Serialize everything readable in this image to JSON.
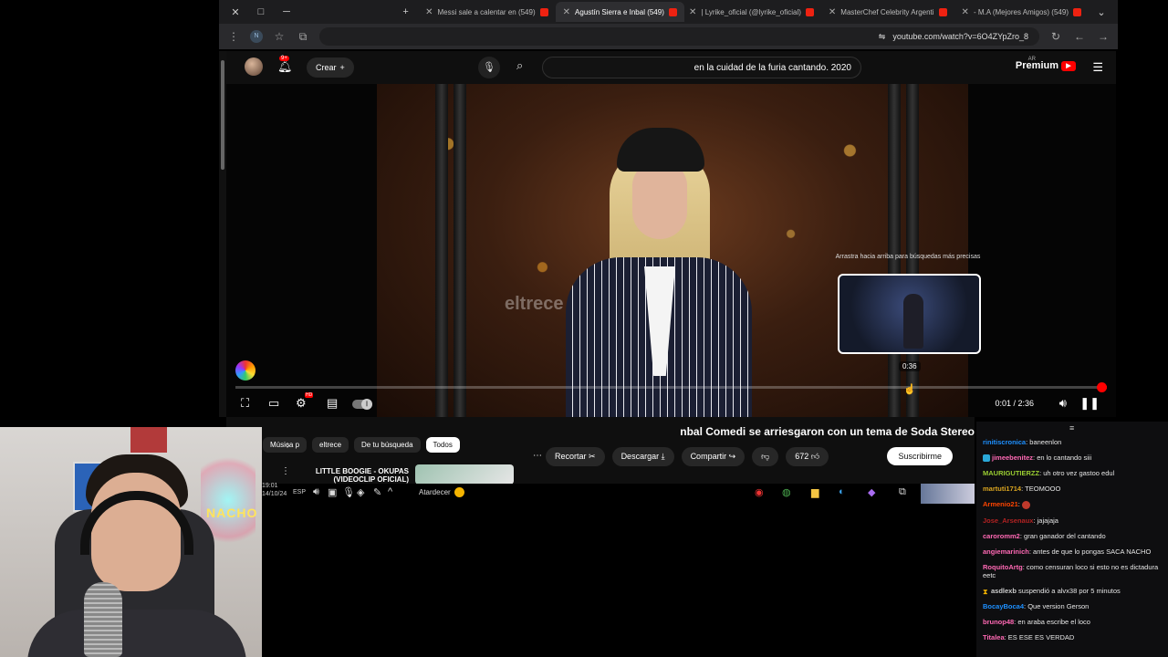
{
  "browser": {
    "tabs": [
      {
        "label": "(549) M.A (Mejores Amigos) -",
        "active": false
      },
      {
        "label": "MasterChef Celebrity Argenti",
        "active": false
      },
      {
        "label": "Lyrike_oficial (@lyrike_oficial) |",
        "active": false
      },
      {
        "label": "(549) Agustín Sierra e Inbal",
        "active": true
      },
      {
        "label": "(549) Messi sale a calentar en",
        "active": false
      }
    ],
    "url": "youtube.com/watch?v=6O4ZYpZro_8",
    "profile_letter": "N"
  },
  "masthead": {
    "logo_text": "Premium",
    "region": "AR",
    "search_query": "en la cuidad de la furia cantando. 2020",
    "create_label": "Crear",
    "notifications_badge": "9+"
  },
  "player": {
    "tooltip": "Arrastra hacia arriba para búsquedas más precisas",
    "preview_time": "0:36",
    "time_display": "0:01 / 2:36",
    "progress": 0.006,
    "watermark": "eltrece"
  },
  "video": {
    "title": "nbal Comedi se arriesgaron con un tema de Soda Stereo",
    "subscribe_label": "Suscribirme",
    "like_count": "672",
    "actions": {
      "share": "Compartir",
      "download": "Descargar",
      "clip": "Recortar"
    }
  },
  "chips": [
    {
      "label": "Todos",
      "active": true
    },
    {
      "label": "De tu búsqueda",
      "active": false
    },
    {
      "label": "eltrece",
      "active": false
    },
    {
      "label": "Música p",
      "active": false
    }
  ],
  "recommended": {
    "title": "LITTLE BOOGIE - OKUPAS (VIDEOCLIP OFICIAL)"
  },
  "taskbar": {
    "weather": "Atardecer",
    "lang": "ESP",
    "time": "19:01",
    "date": "14/10/24"
  },
  "webcam": {
    "neon_text": "NACHO"
  },
  "chat": {
    "messages": [
      {
        "user": "rinitiscronica",
        "text": "baneenlon",
        "color": "#1e90ff",
        "badge": "none"
      },
      {
        "user": "jimeebenitez",
        "text": "en lo cantando siii",
        "color": "#ff69b4",
        "badge": "sub"
      },
      {
        "user": "MAURIGUTIERZZ",
        "text": "uh otro vez gastoo edul",
        "color": "#9acd32",
        "badge": "none"
      },
      {
        "user": "martuti1714",
        "text": "TEOMOOO",
        "color": "#daa520",
        "badge": "none"
      },
      {
        "user": "Armenio21",
        "text": "",
        "color": "#ff4500",
        "badge": "emote"
      },
      {
        "user": "Jose_Arsenaux",
        "text": "jajajaja",
        "color": "#b22222",
        "badge": "none"
      },
      {
        "user": "caroromm2",
        "text": "gran ganador del cantando",
        "color": "#ff69b4",
        "badge": "none"
      },
      {
        "user": "angiemarinich",
        "text": "antes de que lo pongas SACA NACHO",
        "color": "#ff69b4",
        "badge": "none"
      },
      {
        "user": "RoquitoArtg",
        "text": "como censuran loco si esto no es dictadura eetc",
        "color": "#ff69b4",
        "badge": "none"
      },
      {
        "user": "asdlexb",
        "text": "suspendió a alvx38 por 5 minutos",
        "color": "#cccccc",
        "badge": "mod"
      },
      {
        "user": "BocayBoca4",
        "text": "Que version Gerson",
        "color": "#1e90ff",
        "badge": "none"
      },
      {
        "user": "brunop48",
        "text": "en araba escribe el loco",
        "color": "#ff69b4",
        "badge": "none"
      },
      {
        "user": "Titalea",
        "text": "ES ESE ES VERDAD",
        "color": "#ff69b4",
        "badge": "none"
      }
    ]
  },
  "colors": {
    "accent_red": "#ff0000",
    "chat_bg": "#0e0e10",
    "yt_bg": "#0f0f0f"
  }
}
